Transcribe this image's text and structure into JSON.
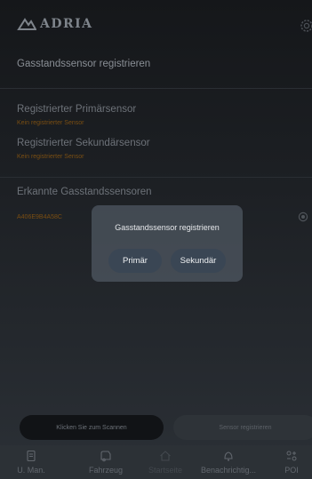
{
  "header": {
    "brand": "ADRIA"
  },
  "page": {
    "title": "Gasstandssensor registrieren"
  },
  "registered": {
    "primary_label": "Registrierter Primärsensor",
    "primary_value": "Kein registrierter Sensor",
    "secondary_label": "Registrierter Sekundärsensor",
    "secondary_value": "Kein registrierter Sensor"
  },
  "detected": {
    "title": "Erkannte Gasstandssensoren",
    "devices": [
      {
        "id": "A406E9B4A58C"
      }
    ]
  },
  "modal": {
    "title": "Gasstandssensor registrieren",
    "primary_button": "Primär",
    "secondary_button": "Sekundär"
  },
  "actions": {
    "scan": "Klicken Sie zum Scannen",
    "register": "Sensor registrieren"
  },
  "nav": {
    "items": [
      {
        "label": "U. Man.",
        "icon": "manual-icon"
      },
      {
        "label": "Fahrzeug",
        "icon": "vehicle-icon"
      },
      {
        "label": "Startseite",
        "icon": "home-icon",
        "active": true
      },
      {
        "label": "Benachrichtig...",
        "icon": "bell-icon"
      },
      {
        "label": "POI",
        "icon": "poi-icon"
      }
    ]
  },
  "colors": {
    "accent_orange": "#7a4e12",
    "background": "#1c1f23",
    "modal_bg": "#58626e",
    "button_bg": "#3a4654"
  }
}
